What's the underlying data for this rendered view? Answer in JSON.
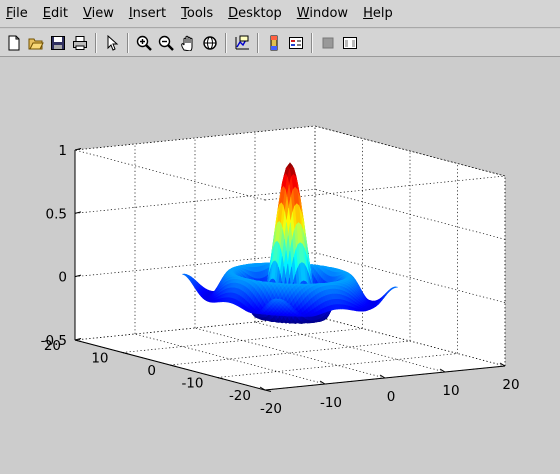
{
  "menu": {
    "items": [
      {
        "mnemonic": "F",
        "rest": "ile"
      },
      {
        "mnemonic": "E",
        "rest": "dit"
      },
      {
        "mnemonic": "V",
        "rest": "iew"
      },
      {
        "mnemonic": "I",
        "rest": "nsert"
      },
      {
        "mnemonic": "T",
        "rest": "ools"
      },
      {
        "mnemonic": "D",
        "rest": "esktop"
      },
      {
        "mnemonic": "W",
        "rest": "indow"
      },
      {
        "mnemonic": "H",
        "rest": "elp"
      }
    ]
  },
  "toolbar": {
    "groups": [
      [
        "new-file-icon",
        "open-folder-icon",
        "save-icon",
        "print-icon"
      ],
      [
        "pointer-arrow-icon"
      ],
      [
        "zoom-in-icon",
        "zoom-out-icon",
        "pan-hand-icon",
        "rotate-3d-icon"
      ],
      [
        "data-cursor-icon"
      ],
      [
        "colorbar-icon",
        "legend-icon"
      ],
      [
        "hide-plot-tools-icon",
        "show-plot-tools-icon"
      ]
    ]
  },
  "chart_data": {
    "type": "surface",
    "function": "sinc of radius: sin(r)/r, r = sqrt(x^2 + y^2)",
    "colormap": "jet",
    "grid": true,
    "xlim": [
      -20,
      20
    ],
    "ylim": [
      -20,
      20
    ],
    "zlim": [
      -0.5,
      1
    ],
    "x_ticks": [
      "-20",
      "-10",
      "0",
      "10",
      "20"
    ],
    "y_ticks": [
      "-20",
      "-10",
      "0",
      "10",
      "20"
    ],
    "z_ticks": [
      "-0.5",
      "0",
      "0.5",
      "1"
    ]
  }
}
